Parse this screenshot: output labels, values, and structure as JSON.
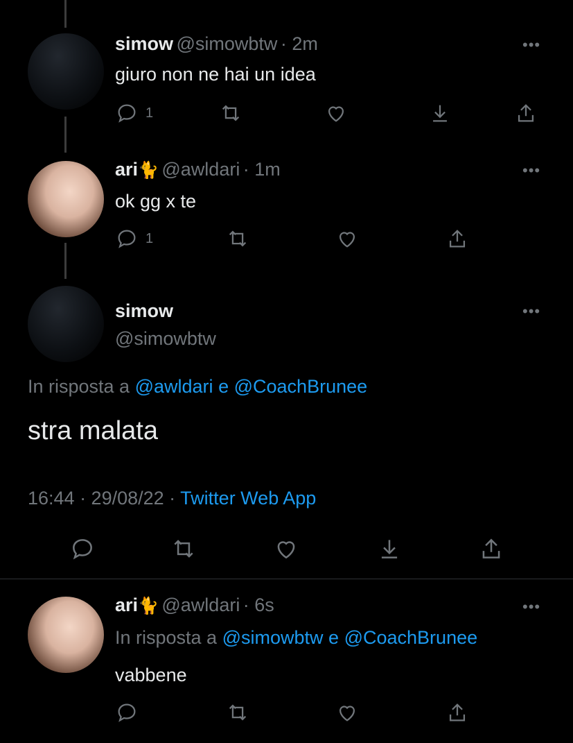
{
  "tweets": [
    {
      "name": "simow",
      "handle": "@simowbtw",
      "time": "· 2m",
      "text": "giuro non ne hai un idea",
      "reply_count": "1",
      "more": "•••"
    },
    {
      "name": "ari",
      "emoji": "🐈",
      "handle": "@awldari",
      "time": "· 1m",
      "text": "ok gg x te",
      "reply_count": "1",
      "more": "•••"
    }
  ],
  "main": {
    "name": "simow",
    "handle": "@simowbtw",
    "more": "•••",
    "reply_prefix": "In risposta a",
    "mention1": "@awldari",
    "conj": "e",
    "mention2": "@CoachBrunee",
    "text": "stra malata",
    "time": "16:44 · 29/08/22 ·",
    "source": "Twitter Web App"
  },
  "last": {
    "name": "ari",
    "emoji": "🐈",
    "handle": "@awldari",
    "time": "· 6s",
    "more": "•••",
    "reply_prefix": "In risposta a",
    "mention1": "@simowbtw",
    "conj": "e",
    "mention2": "@CoachBrunee",
    "text": "vabbene"
  },
  "icons": [
    "reply-icon",
    "retweet-icon",
    "like-icon",
    "download-icon",
    "share-icon"
  ],
  "colors": {
    "background": "#000000",
    "text": "#e7e9ea",
    "muted": "#71767b",
    "link": "#1d9bf0"
  }
}
